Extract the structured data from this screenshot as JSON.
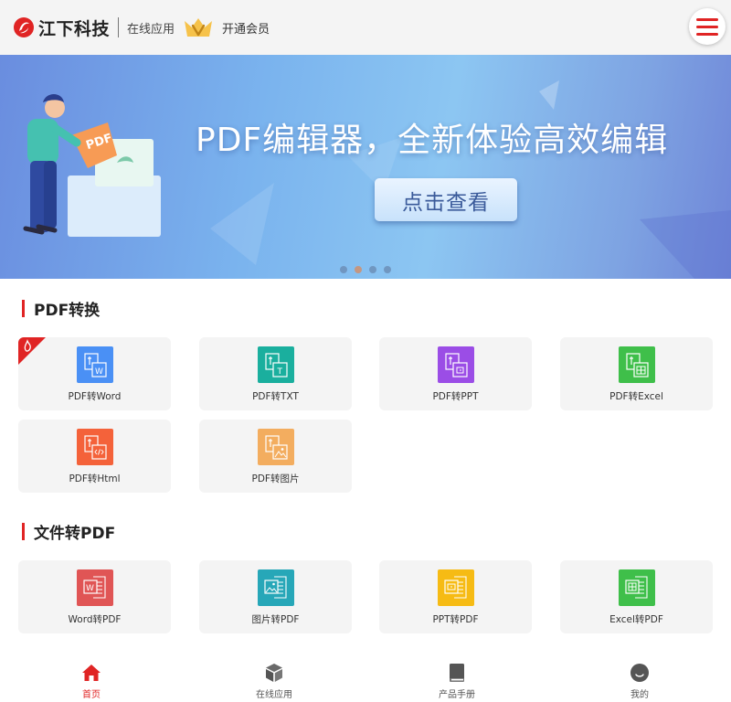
{
  "header": {
    "brand": "江下科技",
    "nav_online": "在线应用",
    "vip": "开通会员",
    "accent_color": "#e02424"
  },
  "banner": {
    "title": "PDF编辑器，全新体验高效编辑",
    "button_label": "点击查看",
    "illustration_badge": "PDF",
    "slides_count": 4,
    "active_slide": 2
  },
  "sections": [
    {
      "title": "PDF转换",
      "items": [
        {
          "label": "PDF转Word",
          "icon": "pdf-to-word-icon",
          "color": "#4a90f5",
          "hot": true
        },
        {
          "label": "PDF转TXT",
          "icon": "pdf-to-txt-icon",
          "color": "#1aaf9e",
          "hot": false
        },
        {
          "label": "PDF转PPT",
          "icon": "pdf-to-ppt-icon",
          "color": "#9b4de6",
          "hot": false
        },
        {
          "label": "PDF转Excel",
          "icon": "pdf-to-excel-icon",
          "color": "#3fbf4a",
          "hot": false
        },
        {
          "label": "PDF转Html",
          "icon": "pdf-to-html-icon",
          "color": "#f4623a",
          "hot": false
        },
        {
          "label": "PDF转图片",
          "icon": "pdf-to-image-icon",
          "color": "#f3ad5f",
          "hot": false
        }
      ]
    },
    {
      "title": "文件转PDF",
      "items": [
        {
          "label": "Word转PDF",
          "icon": "word-to-pdf-icon",
          "color": "#e05555",
          "hot": false
        },
        {
          "label": "图片转PDF",
          "icon": "image-to-pdf-icon",
          "color": "#27a7b8",
          "hot": false
        },
        {
          "label": "PPT转PDF",
          "icon": "ppt-to-pdf-icon",
          "color": "#f6bb14",
          "hot": false
        },
        {
          "label": "Excel转PDF",
          "icon": "excel-to-pdf-icon",
          "color": "#3fbf4a",
          "hot": false
        }
      ]
    }
  ],
  "bottom_nav": [
    {
      "label": "首页",
      "icon": "home-icon",
      "active": true
    },
    {
      "label": "在线应用",
      "icon": "cube-icon",
      "active": false
    },
    {
      "label": "产品手册",
      "icon": "book-icon",
      "active": false
    },
    {
      "label": "我的",
      "icon": "user-icon",
      "active": false
    }
  ]
}
